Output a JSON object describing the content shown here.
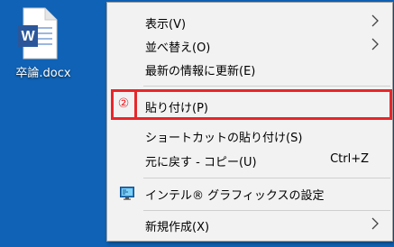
{
  "desktop": {
    "file": {
      "name": "卒論.docx",
      "icon": "word-document-icon",
      "icon_letter": "W"
    }
  },
  "context_menu": {
    "items": [
      {
        "label": "表示(V)",
        "submenu": true
      },
      {
        "label": "並べ替え(O)",
        "submenu": true
      },
      {
        "label": "最新の情報に更新(E)"
      },
      {
        "label": "貼り付け(P)",
        "highlighted": true
      },
      {
        "label": "ショートカットの貼り付け(S)"
      },
      {
        "label": "元に戻す - コピー(U)",
        "shortcut": "Ctrl+Z"
      },
      {
        "label": "インテル® グラフィックスの設定",
        "icon": "intel-graphics-icon"
      },
      {
        "label": "新規作成(X)",
        "submenu": true
      }
    ]
  },
  "annotation": {
    "step": "②",
    "color": "#e8262a"
  },
  "colors": {
    "desktop_bg": "#0f62b5",
    "menu_bg": "#f2f2f2"
  }
}
